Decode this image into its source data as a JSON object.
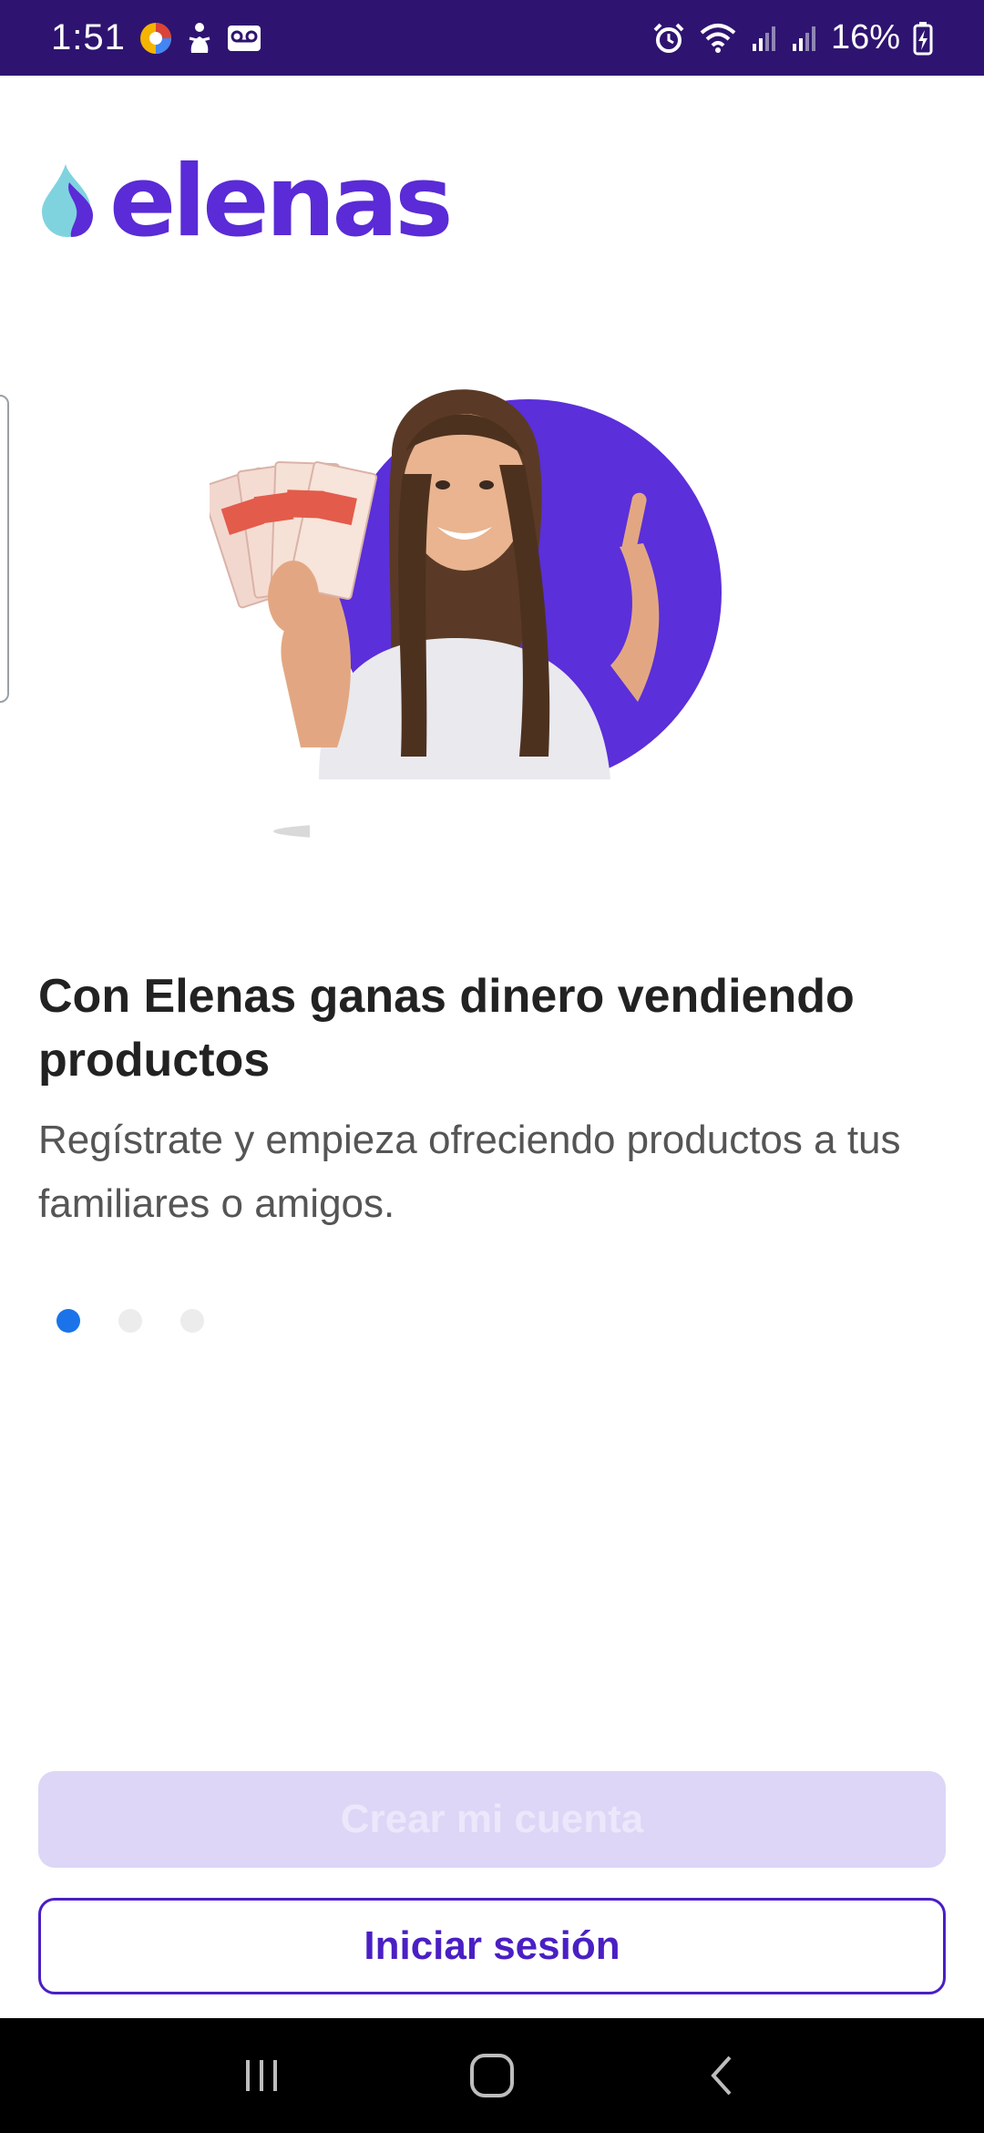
{
  "status_bar": {
    "time": "1:51",
    "battery_percent": "16%",
    "left_icons": [
      "browser-icon",
      "figure-icon",
      "voicemail-icon"
    ],
    "right_icons": [
      "alarm-icon",
      "wifi-icon",
      "signal-icon",
      "signal-icon",
      "battery-charging-icon"
    ]
  },
  "logo": {
    "text": "elenas",
    "brand_color": "#5a2bd6",
    "accent_color": "#7fd3df"
  },
  "onboarding": {
    "headline": "Con Elenas ganas dinero vendiendo productos",
    "subtext": "Regístrate y empieza ofreciendo productos a tus familiares o amigos.",
    "pages_total": 3,
    "active_page": 1
  },
  "buttons": {
    "create_account": "Crear mi cuenta",
    "login": "Iniciar sesión"
  },
  "nav_bar": {
    "icons": [
      "recent-apps-icon",
      "home-icon",
      "back-icon"
    ]
  },
  "colors": {
    "status_bar": "#2e1470",
    "primary": "#4a1fc4",
    "primary_disabled": "#ddd6f6",
    "dot_active": "#1a73e8"
  }
}
